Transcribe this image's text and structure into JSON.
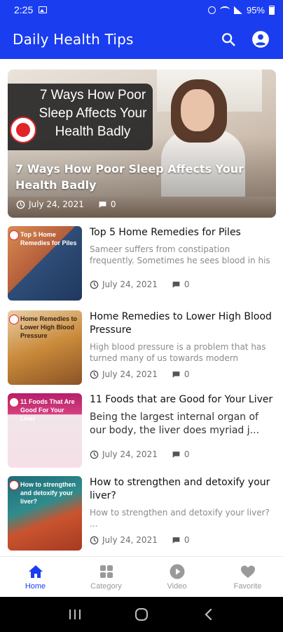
{
  "status_bar": {
    "time": "2:25",
    "battery": "95%"
  },
  "app_bar": {
    "title": "Daily Health Tips"
  },
  "featured": {
    "promo_text": "7 Ways How Poor Sleep Affects Your Health Badly",
    "title": "7 Ways How Poor Sleep Affects Your Health Badly",
    "date": "July 24, 2021",
    "comments": "0"
  },
  "articles": [
    {
      "thumb_caption": "Top 5 Home Remedies for Piles",
      "title": "Top 5 Home Remedies for Piles",
      "excerpt": "Sameer suffers from constipation frequently. Sometimes he sees blood in his motions. He ...",
      "date": "July 24, 2021",
      "comments": "0"
    },
    {
      "thumb_caption": "Home Remedies to Lower High Blood Pressure",
      "title": "Home Remedies to Lower High Blood Pressure",
      "excerpt": "High blood pressure is a problem that has turned many of us towards modern medic...",
      "date": "July 24, 2021",
      "comments": "0"
    },
    {
      "thumb_caption": "11 Foods That Are Good For Your Liver",
      "title": "11 Foods that are Good for Your Liver",
      "excerpt": "Being the largest internal organ of our body, the liver does myriad j...",
      "date": "July 24, 2021",
      "comments": "0"
    },
    {
      "thumb_caption": "How to strengthen and detoxify your liver?",
      "title": "How to strengthen and detoxify your liver?",
      "excerpt": "How to strengthen and detoxify your liver? ...",
      "date": "July 24, 2021",
      "comments": "0"
    }
  ],
  "bottom_nav": {
    "items": [
      {
        "label": "Home",
        "icon": "home-icon",
        "active": true
      },
      {
        "label": "Category",
        "icon": "grid-icon",
        "active": false
      },
      {
        "label": "Video",
        "icon": "play-circle-icon",
        "active": false
      },
      {
        "label": "Favorite",
        "icon": "heart-icon",
        "active": false
      }
    ]
  },
  "colors": {
    "primary": "#1a3df0",
    "inactive": "#9a9a9a",
    "brand_red": "#e2242a"
  }
}
